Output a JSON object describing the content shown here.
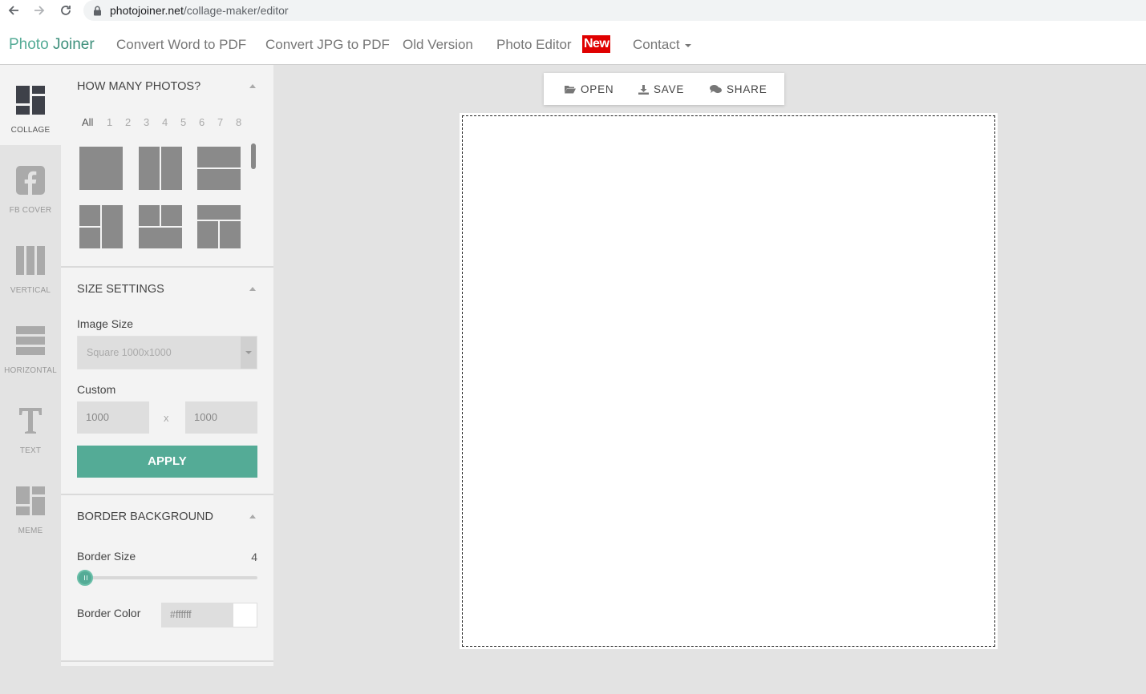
{
  "browser": {
    "url_host": "photojoiner.net",
    "url_path": "/collage-maker/editor"
  },
  "header": {
    "brand_part1": "Photo",
    "brand_part2": "Joiner",
    "nav": [
      {
        "label": "Convert Word to PDF"
      },
      {
        "label": "Convert JPG to PDF"
      },
      {
        "label": "Old Version"
      },
      {
        "label": "Photo Editor"
      },
      {
        "label": "Contact"
      }
    ],
    "new_badge": "New"
  },
  "rail": {
    "items": [
      {
        "label": "COLLAGE",
        "icon": "collage-icon",
        "active": true
      },
      {
        "label": "FB COVER",
        "icon": "facebook-icon"
      },
      {
        "label": "VERTICAL",
        "icon": "vertical-layout-icon"
      },
      {
        "label": "HORIZONTAL",
        "icon": "horizontal-layout-icon"
      },
      {
        "label": "TEXT",
        "icon": "text-icon"
      },
      {
        "label": "MEME",
        "icon": "meme-icon"
      }
    ]
  },
  "panel": {
    "how_many": {
      "title": "HOW MANY PHOTOS?",
      "filters": [
        "All",
        "1",
        "2",
        "3",
        "4",
        "5",
        "6",
        "7",
        "8"
      ],
      "active_filter": "All"
    },
    "size": {
      "title": "SIZE SETTINGS",
      "image_size_label": "Image Size",
      "image_size_value": "Square 1000x1000",
      "custom_label": "Custom",
      "width": "1000",
      "height": "1000",
      "separator": "x",
      "apply_label": "APPLY"
    },
    "border": {
      "title": "BORDER BACKGROUND",
      "size_label": "Border Size",
      "size_value": "4",
      "color_label": "Border Color",
      "color_value": "#ffffff"
    }
  },
  "toolbar": {
    "open": "OPEN",
    "save": "SAVE",
    "share": "SHARE"
  },
  "colors": {
    "accent": "#54ab96",
    "new_badge": "#e00000",
    "canvas_bg": "#ffffff",
    "workspace_bg": "#e3e3e3"
  }
}
